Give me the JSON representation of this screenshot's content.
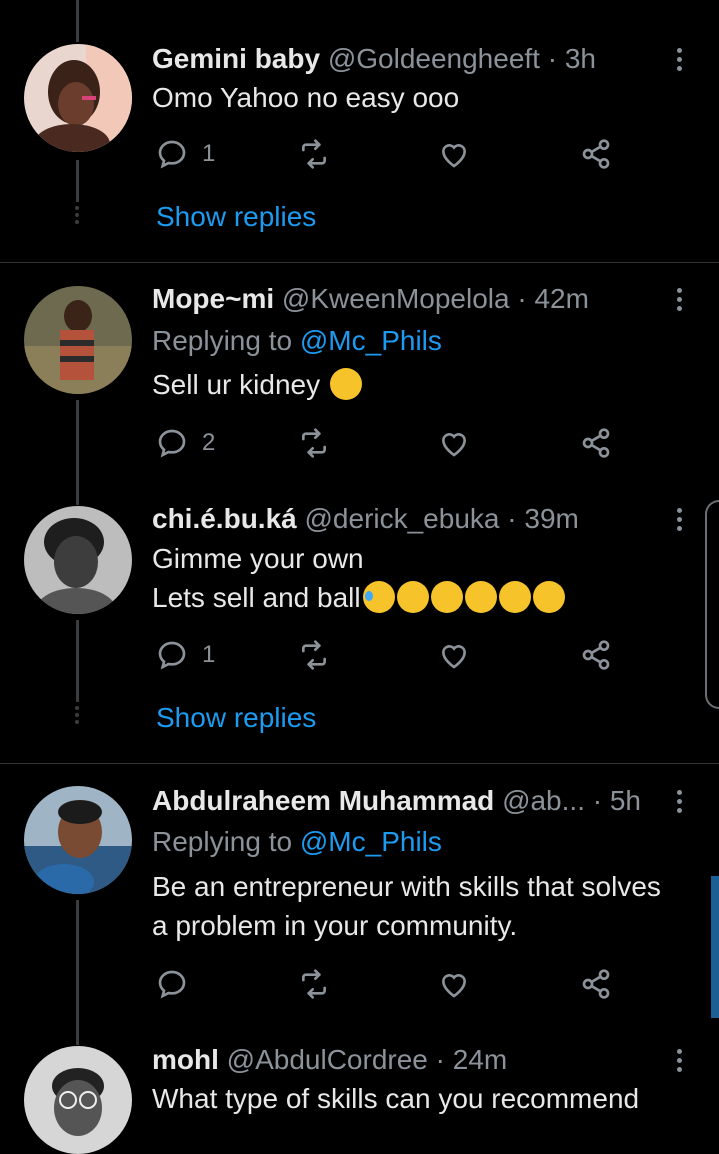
{
  "colors": {
    "background": "#000000",
    "accent": "#1d9bf0",
    "muted": "#8b9299",
    "text": "#e8e8e8",
    "divider": "#2f3336"
  },
  "replies": [
    {
      "name": "Gemini baby",
      "handle": "@Goldeengheeft",
      "separator": "·",
      "time": "3h",
      "lines": [
        "Omo Yahoo no easy ooo"
      ],
      "reply_count": "1",
      "show_replies": "Show replies"
    },
    {
      "name": "Mope~mi",
      "handle": "@KweenMopelola",
      "separator": "·",
      "time": "42m",
      "replying_to_label": "Replying to",
      "replying_to_user": "@Mc_Phils",
      "lines": [
        "Sell ur kidney"
      ],
      "emoji": [
        "rolling-eyes-emoji"
      ],
      "reply_count": "2"
    },
    {
      "name": "chi.é.bu.ká",
      "handle": "@derick_ebuka",
      "separator": "·",
      "time": "39m",
      "lines": [
        "Gimme your own",
        "Lets sell and ball"
      ],
      "emoji": [
        "sweat-smile-emoji",
        "tears-of-joy-emoji",
        "tears-of-joy-emoji",
        "smirk-emoji",
        "smirk-emoji",
        "smirk-emoji"
      ],
      "reply_count": "1",
      "show_replies": "Show replies"
    },
    {
      "name": "Abdulraheem Muhammad",
      "handle": "@ab...",
      "separator": "·",
      "time": "5h",
      "replying_to_label": "Replying to",
      "replying_to_user": "@Mc_Phils",
      "lines": [
        "Be an entrepreneur with skills that solves",
        "a problem in your community."
      ],
      "reply_count": ""
    },
    {
      "name": "mohl",
      "handle": "@AbdulCordree",
      "separator": "·",
      "time": "24m",
      "lines": [
        "What type of skills can you recommend"
      ]
    }
  ]
}
